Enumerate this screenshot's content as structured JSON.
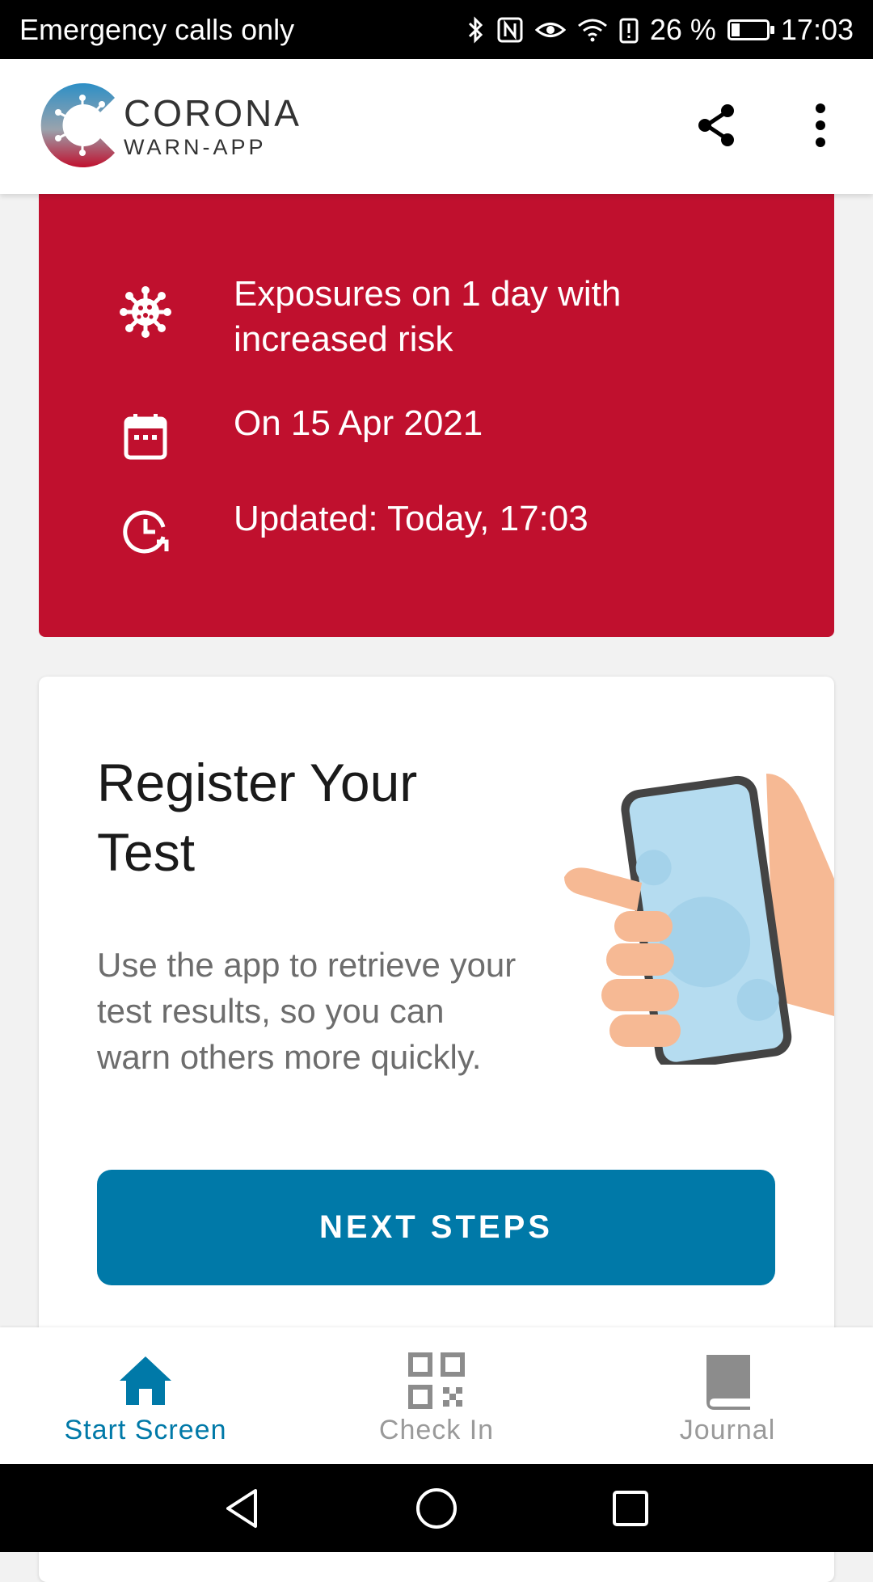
{
  "status_bar": {
    "carrier": "Emergency calls only",
    "battery": "26 %",
    "time": "17:03",
    "icons": [
      "bluetooth-icon",
      "nfc-icon",
      "eye-icon",
      "wifi-icon",
      "battery-alert-icon",
      "battery-icon"
    ]
  },
  "app_bar": {
    "brand_name": "CORONA",
    "brand_sub": "WARN-APP",
    "icons": [
      "share-icon",
      "more-vert-icon"
    ]
  },
  "risk_card": {
    "color": "#c0102e",
    "rows": [
      {
        "icon": "virus-icon",
        "text": "Exposures on 1 day with increased risk"
      },
      {
        "icon": "calendar-icon",
        "text": "On 15 Apr 2021"
      },
      {
        "icon": "clock-refresh-icon",
        "text": "Updated: Today, 17:03"
      }
    ]
  },
  "test_card": {
    "title": "Register Your Test",
    "body": "Use the app to retrieve your test results, so you can warn others more quickly.",
    "button_label": "NEXT STEPS",
    "button_color": "#0079a8"
  },
  "bottom_nav": {
    "items": [
      {
        "label": "Start Screen",
        "icon": "home-icon",
        "active": true
      },
      {
        "label": "Check In",
        "icon": "qr-code-icon",
        "active": false
      },
      {
        "label": "Journal",
        "icon": "journal-book-icon",
        "active": false
      }
    ],
    "active_color": "#0079a8"
  },
  "system_nav": {
    "icons": [
      "back-icon",
      "home-circle-icon",
      "recents-icon"
    ]
  }
}
